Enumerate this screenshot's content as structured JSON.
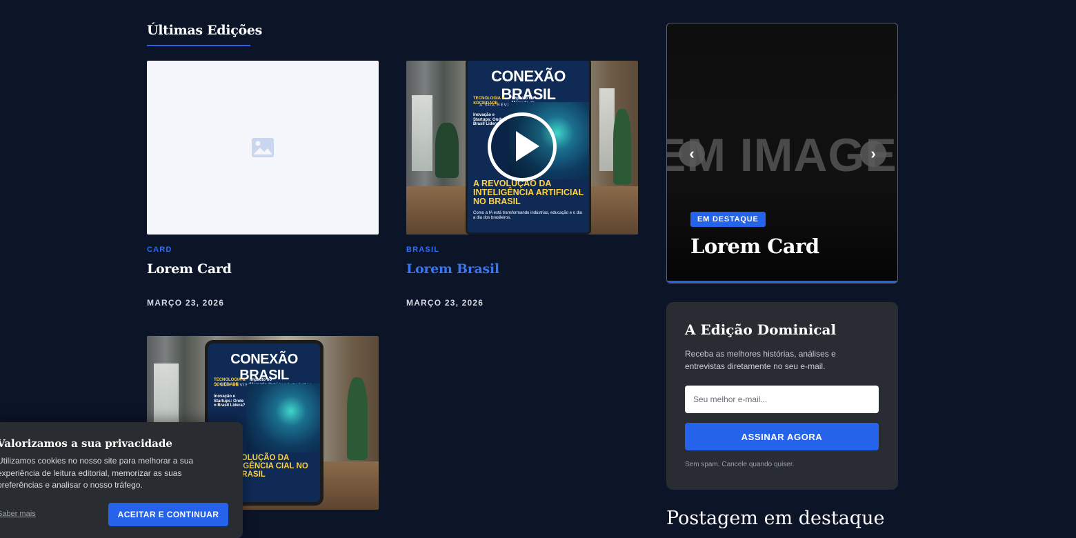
{
  "section": {
    "title": "Últimas Edições"
  },
  "cards": [
    {
      "category": "CARD",
      "title": "Lorem Card",
      "date": "MARÇO 23, 2026"
    },
    {
      "category": "BRASIL",
      "title": "Lorem Brasil",
      "date": "MARÇO 23, 2026"
    }
  ],
  "cover": {
    "brand": "CONEXÃO BRASIL",
    "subtitle": "A SUA REVISTA DE NOTÍCIAS DIGITAL",
    "tag1": "TECNOLOGIA & SOCIEDADE",
    "tag2": "Impacto no Mercado de Trabalho",
    "side": "Inovação e Startups: Onde o Brasil Lidera?",
    "headline": "A REVOLUÇÃO DA INTELIGÊNCIA ARTIFICIAL NO BRASIL",
    "headline_partial": "VOLUÇÃO DA LIGÊNCIA CIAL NO BRASIL",
    "caption": "Como a IA está transformando indústrias, educação e o dia a dia dos brasileiros."
  },
  "featured": {
    "ghost_text": "EM IMAGE",
    "badge": "EM DESTAQUE",
    "title": "Lorem Card",
    "prev_glyph": "‹",
    "next_glyph": "›"
  },
  "newsletter": {
    "title": "A Edição Dominical",
    "description": "Receba as melhores histórias, análises e entrevistas diretamente no seu e-mail.",
    "email_placeholder": "Seu melhor e-mail...",
    "button": "ASSINAR AGORA",
    "note": "Sem spam. Cancele quando quiser."
  },
  "postagem": {
    "title": "Postagem em destaque"
  },
  "cookie": {
    "title": "Valorizamos a sua privacidade",
    "text": "Utilizamos cookies no nosso site para melhorar a sua experiência de leitura editorial, memorizar as suas preferências e analisar o nosso tráfego.",
    "link": "Saber mais",
    "button": "ACEITAR E CONTINUAR"
  },
  "colors": {
    "background": "#0c1428",
    "accent": "#2563eb",
    "panel": "#292d33"
  },
  "icons": {
    "placeholder": "image-placeholder-icon",
    "play": "play-icon"
  }
}
